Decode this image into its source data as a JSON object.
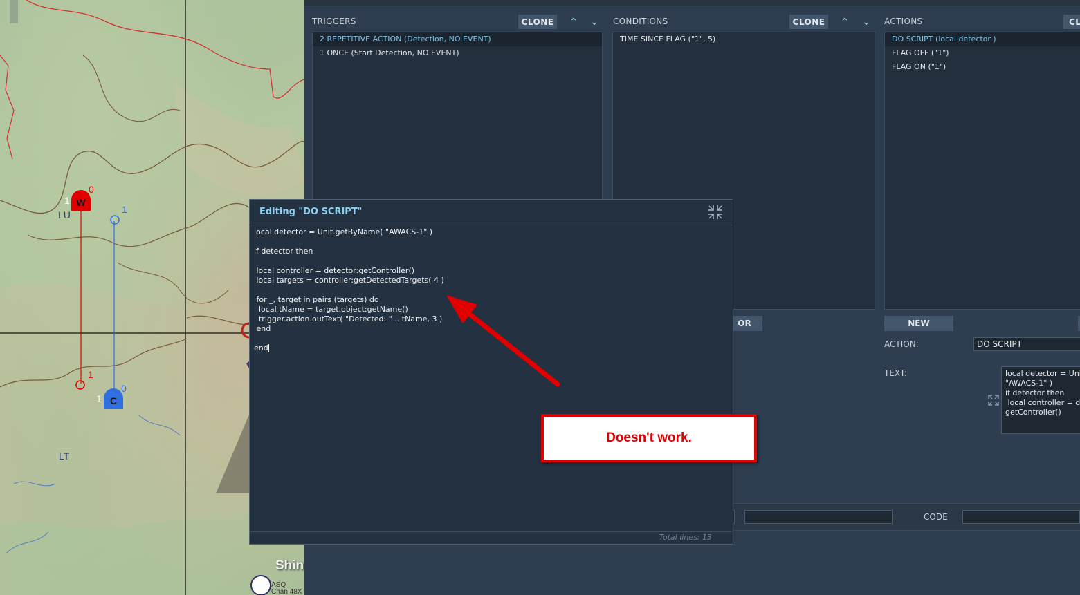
{
  "map": {
    "labels": [
      "LU",
      "LT"
    ],
    "units": [
      {
        "letter": "W",
        "color": "#e00000",
        "num_left": "1",
        "num_right": "0",
        "line_end_num": "1"
      },
      {
        "letter": "C",
        "color": "#2f6fe0",
        "num_left": "1",
        "num_right": "0",
        "line_end_num": "1"
      }
    ],
    "place_name": "Shin",
    "icon_text_1": "ASQ",
    "icon_text_2": "Chan 48X"
  },
  "triggers": {
    "header": "TRIGGERS",
    "clone_label": "CLONE",
    "items": [
      "2 REPETITIVE ACTION (Detection, NO EVENT)",
      "1 ONCE (Start Detection, NO EVENT)"
    ]
  },
  "conditions": {
    "header": "CONDITIONS",
    "clone_label": "CLONE",
    "items": [
      "TIME SINCE FLAG (\"1\", 5)"
    ],
    "or_label": "OR"
  },
  "actions": {
    "header": "ACTIONS",
    "clone_label": "CLONE",
    "items": [
      "DO SCRIPT (local detector )",
      "FLAG OFF (\"1\")",
      "FLAG ON (\"1\")"
    ],
    "new_label": "NEW",
    "action_label": "ACTION:",
    "action_value": "DO SCRIPT",
    "text_label": "TEXT:",
    "text_preview": [
      "local detector = Unit.getByName(",
      "\"AWACS-1\" )",
      "",
      "if detector then",
      "",
      " local controller = detector:",
      "getController()"
    ]
  },
  "bottom": {
    "code_label": "CODE"
  },
  "dialog": {
    "title": "Editing \"DO SCRIPT\"",
    "code_lines": [
      "local detector = Unit.getByName( \"AWACS-1\" )",
      "",
      "if detector then",
      "",
      " local controller = detector:getController()",
      " local targets = controller:getDetectedTargets( 4 )",
      "",
      " for _, target in pairs (targets) do",
      "  local tName = target.object:getName()",
      "  trigger.action.outText( \"Detected: \" .. tName, 3 )",
      " end",
      "",
      "end"
    ],
    "total_lines_label": "Total lines:  13"
  },
  "annotation": {
    "text": "Doesn't work.",
    "color": "#e00000"
  }
}
